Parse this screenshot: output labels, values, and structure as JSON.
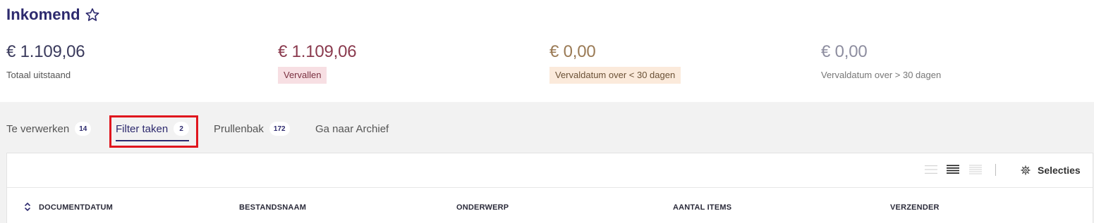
{
  "page": {
    "title": "Inkomend",
    "favorite_icon": "star-outline-icon"
  },
  "kpis": [
    {
      "amount": "€ 1.109,06",
      "label": "Totaal uitstaand"
    },
    {
      "amount": "€ 1.109,06",
      "label": "Vervallen",
      "accent": "#8a3a4e",
      "badge_bg": "#f7dfe3"
    },
    {
      "amount": "€ 0,00",
      "label": "Vervaldatum over < 30 dagen",
      "accent": "#9a7a55",
      "badge_bg": "#fbeadb"
    },
    {
      "amount": "€ 0,00",
      "label": "Vervaldatum over > 30 dagen"
    }
  ],
  "tabs": [
    {
      "label": "Te verwerken",
      "count": "14"
    },
    {
      "label": "Filter taken",
      "count": "2",
      "active": true
    },
    {
      "label": "Prullenbak",
      "count": "172"
    },
    {
      "label": "Ga naar Archief"
    }
  ],
  "toolbar": {
    "view_icons": [
      "list-compact-icon",
      "list-medium-icon",
      "list-wide-icon"
    ],
    "selections_icon": "gear-icon",
    "selections_label": "Selecties"
  },
  "table": {
    "sort_icon": "sort-updown-icon",
    "columns": [
      "DOCUMENTDATUM",
      "BESTANDSNAAM",
      "ONDERWERP",
      "AANTAL ITEMS",
      "VERZENDER"
    ]
  },
  "colors": {
    "brand": "#2d2a6e",
    "highlight": "#e0161e",
    "background_gray": "#f2f2f2"
  }
}
